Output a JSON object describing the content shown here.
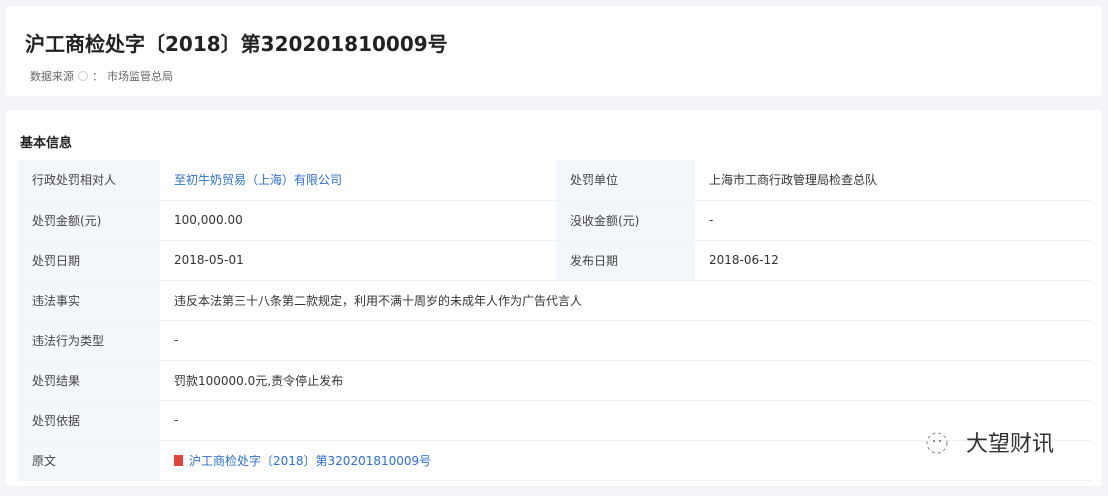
{
  "header": {
    "title": "沪工商检处字〔2018〕第320201810009号",
    "source_label": "数据来源",
    "source_sep": "：",
    "source_value": "市场监管总局"
  },
  "section": {
    "title": "基本信息"
  },
  "rows": [
    {
      "l1": "行政处罚相对人",
      "v1": "至初牛奶贸易（上海）有限公司",
      "l2": "处罚单位",
      "v2": "上海市工商行政管理局检查总队"
    },
    {
      "l1": "处罚金额(元)",
      "v1": "100,000.00",
      "l2": "没收金额(元)",
      "v2": "-"
    },
    {
      "l1": "处罚日期",
      "v1": "2018-05-01",
      "l2": "发布日期",
      "v2": "2018-06-12"
    }
  ],
  "wide_rows": [
    {
      "l": "违法事实",
      "v": "违反本法第三十八条第二款规定，利用不满十周岁的未成年人作为广告代言人"
    },
    {
      "l": "违法行为类型",
      "v": "-"
    },
    {
      "l": "处罚结果",
      "v": "罚款100000.0元,责令停止发布"
    },
    {
      "l": "处罚依据",
      "v": "-"
    },
    {
      "l": "原文",
      "v": "沪工商检处字〔2018〕第320201810009号"
    }
  ],
  "watermark": "大望财讯"
}
